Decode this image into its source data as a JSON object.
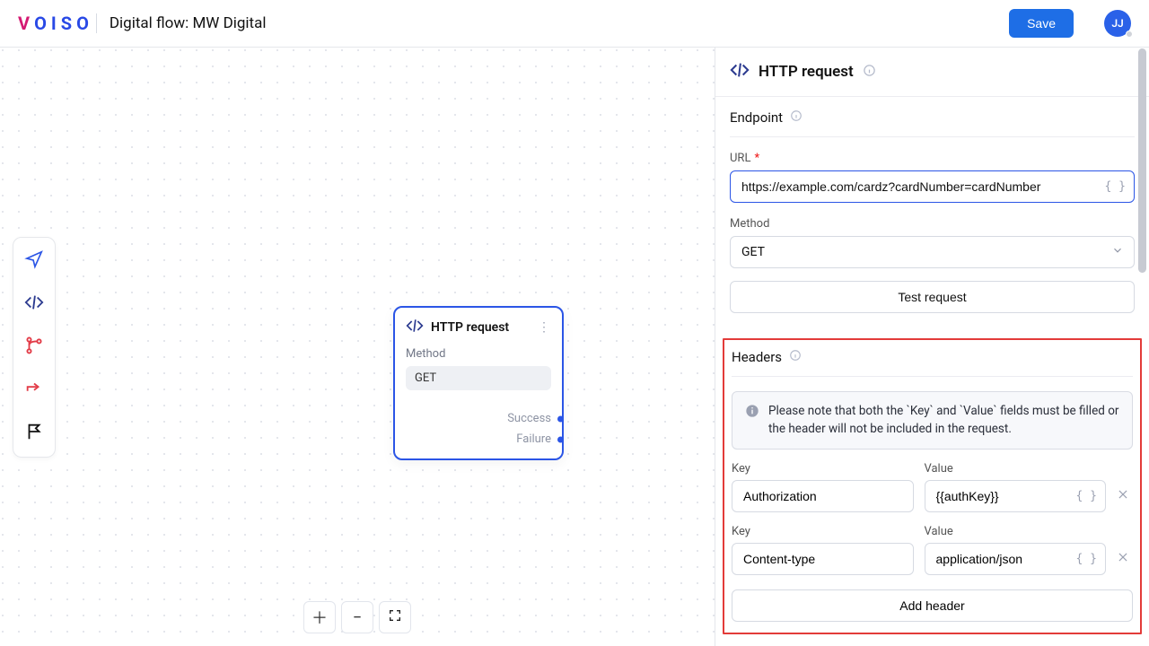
{
  "brand": {
    "letters": [
      "V",
      "O",
      "I",
      "S",
      "O"
    ]
  },
  "page_title": "Digital flow: MW Digital",
  "save_label": "Save",
  "avatar_initials": "JJ",
  "node": {
    "title": "HTTP request",
    "method_label": "Method",
    "method_value": "GET",
    "out_success": "Success",
    "out_failure": "Failure"
  },
  "panel": {
    "title": "HTTP request",
    "endpoint_label": "Endpoint",
    "url_label": "URL",
    "url_value": "https://example.com/cardz?cardNumber=cardNumber",
    "method_label": "Method",
    "method_value": "GET",
    "test_label": "Test request",
    "headers_label": "Headers",
    "note": "Please note that both the `Key` and `Value` fields must be filled or the header will not be included in the request.",
    "key_label": "Key",
    "value_label": "Value",
    "headers": [
      {
        "key": "Authorization",
        "value": "{{authKey}}"
      },
      {
        "key": "Content-type",
        "value": "application/json"
      }
    ],
    "add_header_label": "Add header"
  }
}
